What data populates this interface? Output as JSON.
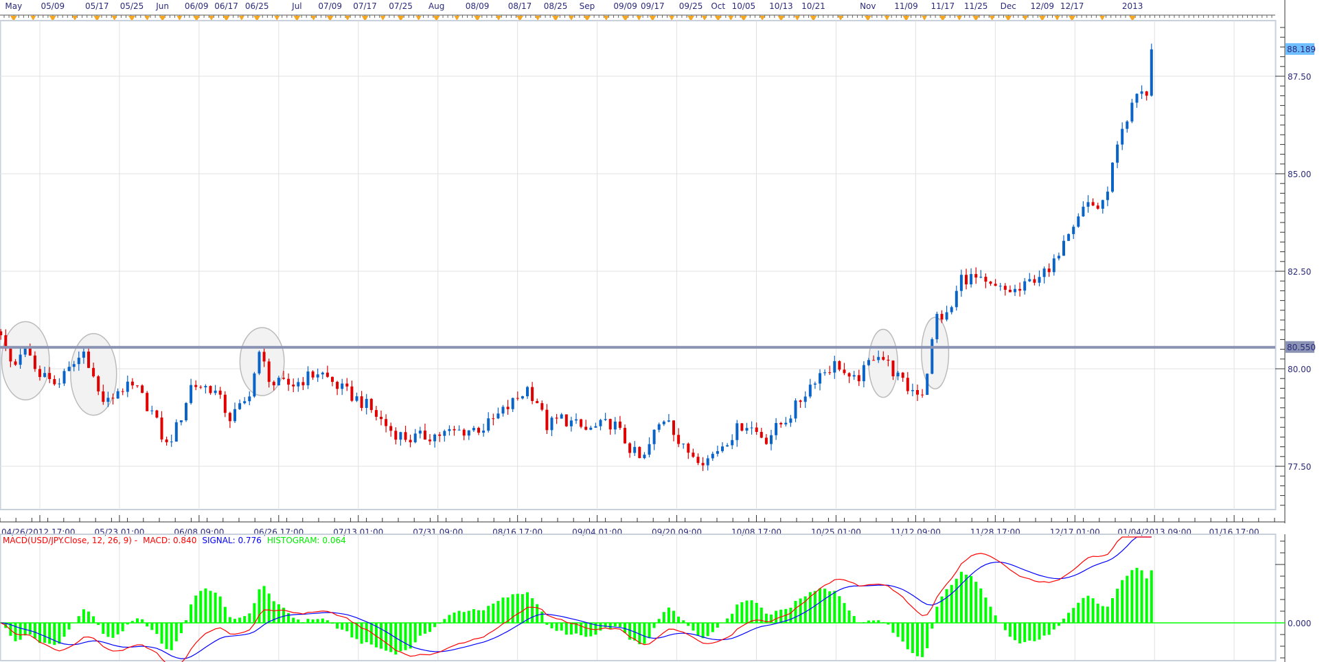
{
  "chart_data": {
    "type": "candlestick",
    "symbol": "USD/JPY",
    "x_unit": "chart time (days from 04/26/2012 17:00, trading-time axis)",
    "close_keyframes": [
      [
        -8.2,
        80.8
      ],
      [
        -5.6,
        79.93
      ],
      [
        -2.9,
        80.48
      ],
      [
        -0.3,
        79.93
      ],
      [
        3.2,
        79.6
      ],
      [
        5.8,
        79.93
      ],
      [
        9.3,
        80.48
      ],
      [
        11.9,
        79.4
      ],
      [
        13.6,
        79.07
      ],
      [
        16.3,
        79.5
      ],
      [
        19.7,
        79.5
      ],
      [
        23.2,
        78.85
      ],
      [
        25.9,
        78.0
      ],
      [
        28.5,
        78.6
      ],
      [
        31.1,
        79.6
      ],
      [
        35.5,
        79.5
      ],
      [
        39.0,
        78.74
      ],
      [
        42.4,
        79.17
      ],
      [
        45.1,
        80.37
      ],
      [
        47.7,
        79.6
      ],
      [
        52.0,
        79.6
      ],
      [
        57.3,
        79.93
      ],
      [
        61.6,
        79.5
      ],
      [
        66.9,
        79.07
      ],
      [
        72.1,
        78.41
      ],
      [
        75.6,
        78.2
      ],
      [
        80.8,
        78.3
      ],
      [
        86.1,
        78.4
      ],
      [
        91.3,
        78.5
      ],
      [
        96.5,
        79.07
      ],
      [
        100.0,
        79.5
      ],
      [
        102.6,
        79.07
      ],
      [
        103.5,
        78.5
      ],
      [
        107.0,
        78.74
      ],
      [
        112.2,
        78.41
      ],
      [
        117.5,
        78.63
      ],
      [
        120.9,
        77.98
      ],
      [
        123.6,
        77.59
      ],
      [
        126.2,
        78.41
      ],
      [
        128.8,
        78.85
      ],
      [
        131.4,
        77.98
      ],
      [
        136.7,
        77.65
      ],
      [
        140.2,
        78.09
      ],
      [
        144.5,
        78.63
      ],
      [
        148.9,
        78.2
      ],
      [
        154.1,
        78.85
      ],
      [
        159.3,
        79.83
      ],
      [
        163.7,
        80.15
      ],
      [
        166.3,
        79.6
      ],
      [
        169.0,
        79.93
      ],
      [
        171.6,
        80.48
      ],
      [
        175.1,
        79.93
      ],
      [
        177.7,
        79.5
      ],
      [
        181.2,
        79.4
      ],
      [
        182.9,
        80.59
      ],
      [
        183.8,
        81.35
      ],
      [
        186.4,
        81.35
      ],
      [
        189.0,
        82.33
      ],
      [
        191.6,
        82.33
      ],
      [
        194.2,
        82.1
      ],
      [
        197.7,
        82.0
      ],
      [
        201.2,
        82.0
      ],
      [
        204.7,
        82.43
      ],
      [
        207.3,
        82.43
      ],
      [
        210.0,
        83.41
      ],
      [
        213.4,
        84.07
      ],
      [
        215.2,
        84.28
      ],
      [
        217.8,
        84.07
      ],
      [
        219.5,
        84.93
      ],
      [
        221.3,
        85.8
      ],
      [
        223.0,
        86.24
      ],
      [
        223.9,
        86.67
      ],
      [
        225.6,
        87.21
      ],
      [
        227.0,
        87.0
      ],
      [
        228.3,
        88.19
      ]
    ],
    "last_price": "88.189",
    "horizontal_line": {
      "value": 80.55,
      "label": "80.550",
      "color": "#8a93b4"
    },
    "y_axis": {
      "range": [
        76.5,
        88.8
      ],
      "ticks": [
        "77.50",
        "80.00",
        "82.50",
        "85.00",
        "87.50"
      ],
      "tick_values": [
        77.5,
        80,
        82.5,
        85,
        87.5
      ]
    },
    "x_axis_bottom_labels": [
      "04/26/2012 17:00",
      "05/23 01:00",
      "06/08 09:00",
      "06/26 17:00",
      "07/13 01:00",
      "07/31 09:00",
      "08/16 17:00",
      "09/04 01:00",
      "09/20 09:00",
      "10/08 17:00",
      "10/25 01:00",
      "11/12 09:00",
      "11/28 17:00",
      "12/17 01:00",
      "01/04/2013 09:00",
      "01/16 17:00"
    ],
    "x_axis_top_labels": [
      "May",
      "05/09",
      "05/17",
      "05/25",
      "Jun",
      "06/09",
      "06/17",
      "06/25",
      "Jul",
      "07/09",
      "07/17",
      "07/25",
      "Aug",
      "08/09",
      "08/17",
      "08/25",
      "Sep",
      "09/09",
      "09/17",
      "09/25",
      "Oct",
      "10/05",
      "10/13",
      "10/21",
      "Nov",
      "11/09",
      "11/17",
      "11/25",
      "Dec",
      "12/09",
      "12/17",
      "2013"
    ],
    "colors": {
      "up": "#0a64c8",
      "down": "#e00000",
      "macd": "#ff0000",
      "signal": "#0000ff",
      "histogram": "#00ff00",
      "last_price_bg": "#6fbfff"
    },
    "macd": {
      "title": "MACD(USD/JPY.Close, 12, 26, 9) -",
      "macd_label": "MACD: 0.840",
      "signal_label": "SIGNAL: 0.776",
      "histogram_label": "HISTOGRAM: 0.064",
      "zero_label": "0.000",
      "params": [
        12,
        26,
        9
      ]
    }
  }
}
